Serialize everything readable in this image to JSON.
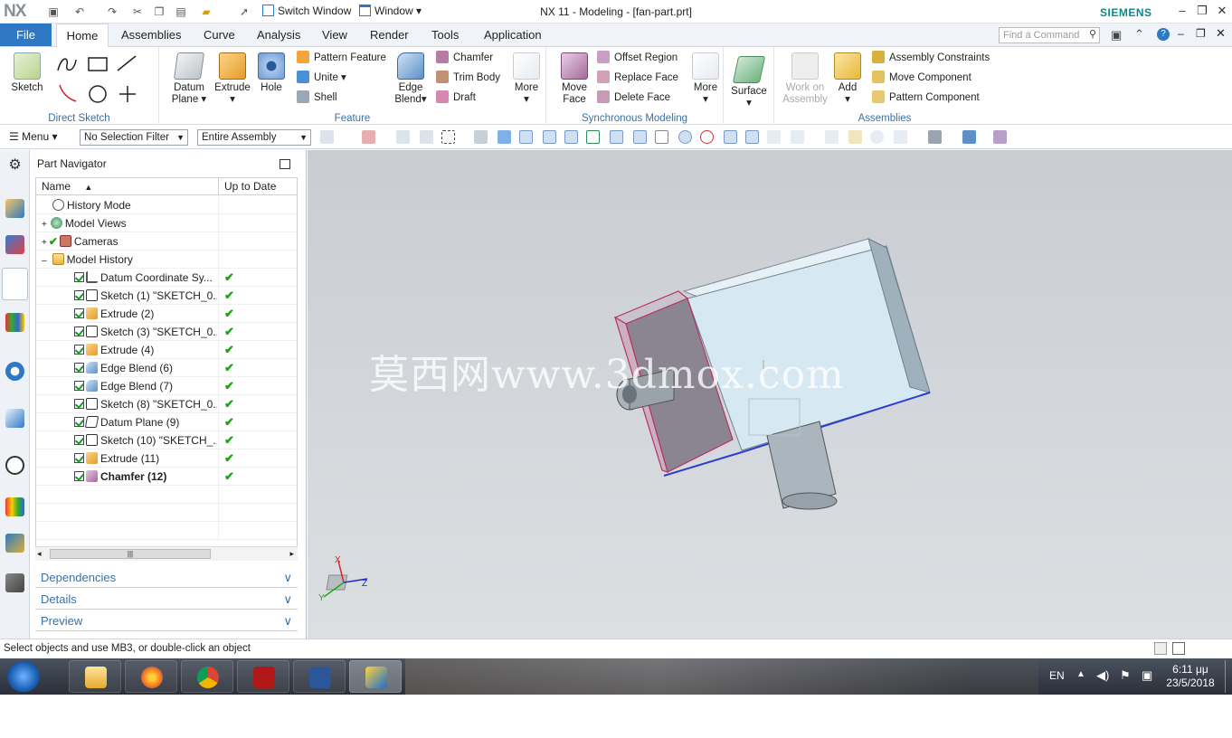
{
  "title_bar": {
    "logo": "NX",
    "title": "NX 11 - Modeling - [fan-part.prt]",
    "brand": "SIEMENS",
    "switch_window": "Switch Window",
    "window_menu": "Window"
  },
  "tabs": {
    "file": "File",
    "items": [
      "Home",
      "Assemblies",
      "Curve",
      "Analysis",
      "View",
      "Render",
      "Tools",
      "Application"
    ],
    "active": "Home",
    "command_finder_placeholder": "Find a Command"
  },
  "ribbon": {
    "direct_sketch": {
      "label": "Direct Sketch",
      "sketch": "Sketch"
    },
    "feature": {
      "label": "Feature",
      "datum_plane": "Datum Plane",
      "extrude": "Extrude",
      "hole": "Hole",
      "pattern_feature": "Pattern Feature",
      "unite": "Unite",
      "shell": "Shell",
      "edge_blend": "Edge Blend",
      "chamfer": "Chamfer",
      "trim_body": "Trim Body",
      "draft": "Draft",
      "more": "More"
    },
    "synchronous": {
      "label": "Synchronous Modeling",
      "move_face": "Move Face",
      "offset_region": "Offset Region",
      "replace_face": "Replace Face",
      "delete_face": "Delete Face",
      "more": "More"
    },
    "surface": {
      "label": "Surface"
    },
    "assemblies": {
      "label": "Assemblies",
      "work_on_assembly": "Work on Assembly",
      "add": "Add",
      "assembly_constraints": "Assembly Constraints",
      "move_component": "Move Component",
      "pattern_component": "Pattern Component"
    }
  },
  "selection_bar": {
    "menu": "Menu",
    "selection_filter": "No Selection Filter",
    "scope": "Entire Assembly"
  },
  "navigator": {
    "title": "Part Navigator",
    "col_name": "Name",
    "col_uptodate": "Up to Date",
    "rows": [
      {
        "label": "History Mode",
        "level": 0
      },
      {
        "label": "Model Views",
        "level": 0
      },
      {
        "label": "Cameras",
        "level": 0
      },
      {
        "label": "Model History",
        "level": 0
      },
      {
        "label": "Datum Coordinate Sy...",
        "level": 1
      },
      {
        "label": "Sketch (1) \"SKETCH_0...",
        "level": 1
      },
      {
        "label": "Extrude (2)",
        "level": 1
      },
      {
        "label": "Sketch (3) \"SKETCH_0...",
        "level": 1
      },
      {
        "label": "Extrude (4)",
        "level": 1
      },
      {
        "label": "Edge Blend (6)",
        "level": 1
      },
      {
        "label": "Edge Blend (7)",
        "level": 1
      },
      {
        "label": "Sketch (8) \"SKETCH_0...",
        "level": 1
      },
      {
        "label": "Datum Plane (9)",
        "level": 1
      },
      {
        "label": "Sketch (10) \"SKETCH_...",
        "level": 1
      },
      {
        "label": "Extrude (11)",
        "level": 1
      },
      {
        "label": "Chamfer (12)",
        "level": 1
      }
    ],
    "panels": [
      "Dependencies",
      "Details",
      "Preview"
    ]
  },
  "viewport": {
    "watermark": "莫西网www.3dmox.com",
    "triad": {
      "x": "X",
      "y": "Y",
      "z": "Z"
    }
  },
  "status": {
    "message": "Select objects and use MB3, or double-click an object"
  },
  "taskbar": {
    "lang": "EN",
    "time": "6:11 μμ",
    "date": "23/5/2018"
  }
}
